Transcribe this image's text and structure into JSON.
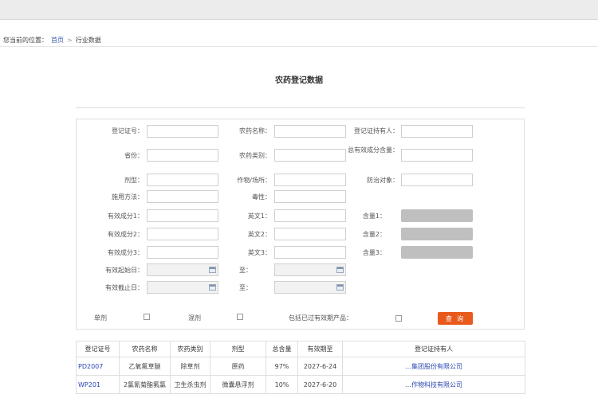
{
  "breadcrumb": {
    "prefix": "您当前的位置：",
    "home": "首页",
    "separator": ">",
    "current": "行业数据"
  },
  "page": {
    "title": "农药登记数据"
  },
  "form": {
    "reg_no_label": "登记证号：",
    "pesticide_name_label": "农药名称：",
    "holder_label": "登记证持有人：",
    "province_label": "省份：",
    "category_label": "农药类别：",
    "total_content_label": "总有效成分含量：",
    "dosage_form_label": "剂型：",
    "crop_label": "作物/场所：",
    "target_label": "防治对象：",
    "usage_label": "施用方法：",
    "toxicity_label": "毒性：",
    "ingredient1_label": "有效成分1：",
    "english1_label": "英文1：",
    "content1_label": "含量1：",
    "ingredient2_label": "有效成分2：",
    "english2_label": "英文2：",
    "content2_label": "含量2：",
    "ingredient3_label": "有效成分3：",
    "english3_label": "英文3：",
    "content3_label": "含量3：",
    "valid_start_label": "有效起始日：",
    "valid_end_label": "有效截止日：",
    "to_label": "至：",
    "single_label": "单剂",
    "mixed_label": "混剂",
    "expired_label": "包括已过有效期产品：",
    "search_button": "查 询"
  },
  "table": {
    "headers": [
      "登记证号",
      "农药名称",
      "农药类别",
      "剂型",
      "总含量",
      "有效期至",
      "登记证持有人"
    ],
    "rows": [
      [
        "PD2007",
        "乙氧氟草醚",
        "除草剂",
        "原药",
        "97%",
        "2027-6-24",
        "…集团股份有限公司"
      ],
      [
        "WP201",
        "2氯氰菊酯氟氯",
        "卫生杀虫剂",
        "微囊悬浮剂",
        "10%",
        "2027-6-20",
        "…作物科技有限公司"
      ]
    ]
  },
  "colors": {
    "topbar": "#ececec",
    "search_button": "#e85a1c",
    "link": "#2b46b0"
  }
}
